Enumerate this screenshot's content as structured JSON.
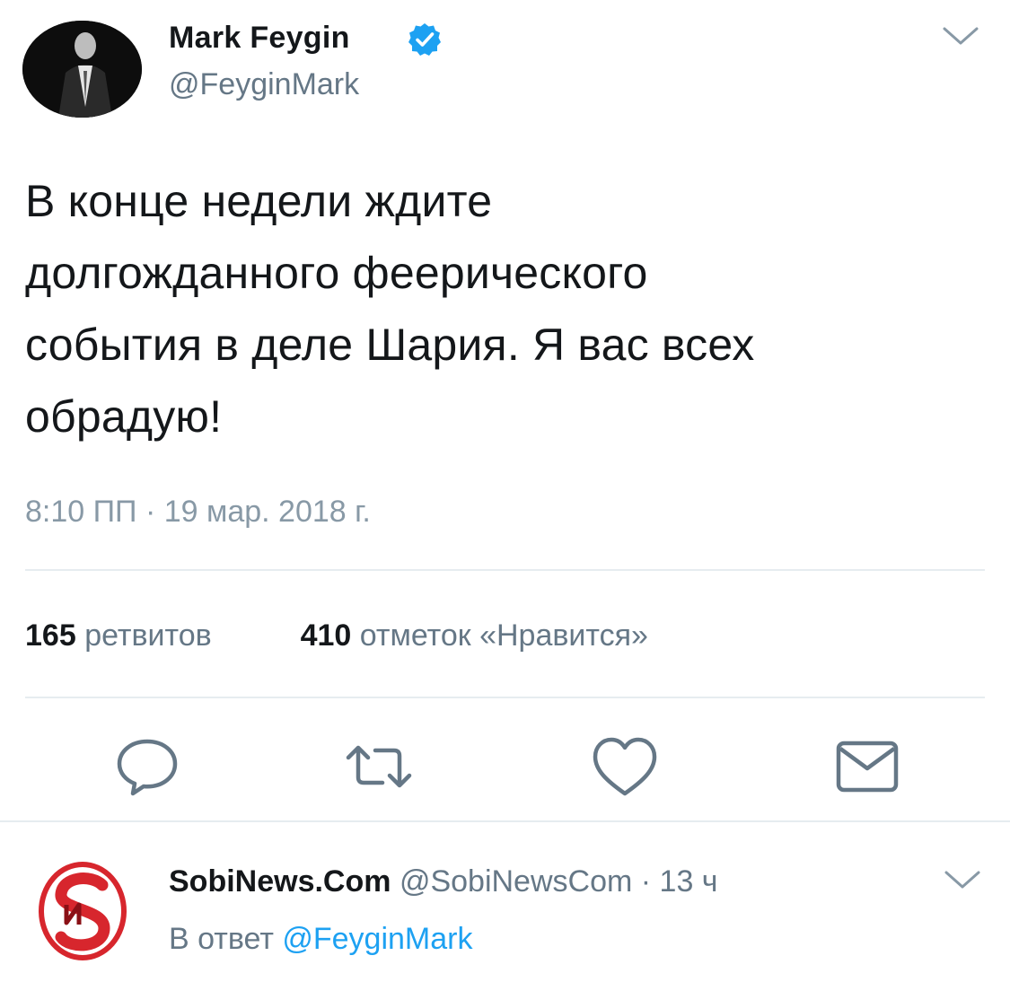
{
  "tweet": {
    "author": {
      "display_name": "Mark Feygin",
      "handle": "@FeyginMark",
      "verified_icon": "verified-badge-icon"
    },
    "text": "В конце недели ждите\nдолгожданного феерического\nсобытия в деле Шария. Я вас всех\nобрадую!",
    "timestamp": "8:10 ПП · 19 мар. 2018 г.",
    "stats": {
      "retweets_count": "165",
      "retweets_label": "ретвитов",
      "likes_count": "410",
      "likes_label": "отметок «Нравится»"
    },
    "actions": [
      "reply-icon",
      "retweet-icon",
      "like-icon",
      "direct-message-icon"
    ]
  },
  "reply": {
    "display_name": "SobiNews.Com",
    "handle": "@SobiNewsCom",
    "separator": "·",
    "time_ago": "13 ч",
    "reply_to_label": "В ответ",
    "reply_to_handle": "@FeyginMark"
  },
  "colors": {
    "text": "#14171a",
    "secondary": "#657786",
    "link": "#1da1f2",
    "verified": "#1da1f2",
    "divider": "#e6ecf0",
    "reply_logo": "#d7262d"
  }
}
